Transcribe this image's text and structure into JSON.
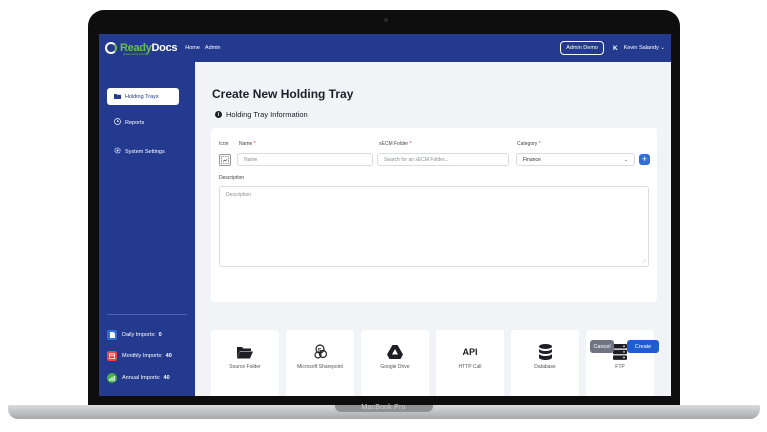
{
  "laptop": {
    "label": "MacBook Pro"
  },
  "topbar": {
    "logo_ready": "Ready",
    "logo_docs": "Docs",
    "logo_sub": "powered by iCenter",
    "nav": [
      "Home",
      "Admin"
    ],
    "admin_demo": "Admin Demo",
    "user_initial": "K",
    "user_name": "Kevin Salandy ⌄"
  },
  "sidebar": {
    "items": [
      {
        "label": "Holding Trays",
        "icon": "folder-icon",
        "active": true
      },
      {
        "label": "Reports",
        "icon": "clock-icon",
        "active": false
      },
      {
        "label": "System Settings",
        "icon": "gear-icon",
        "active": false
      }
    ],
    "stats": [
      {
        "label": "Daily Imports:",
        "value": "0",
        "color": "#2f6fd6",
        "icon": "document-icon"
      },
      {
        "label": "Monthly Imports:",
        "value": "40",
        "color": "#e24a4a",
        "icon": "calendar-icon"
      },
      {
        "label": "Annual Imports:",
        "value": "40",
        "color": "#4caf50",
        "icon": "chart-icon"
      }
    ]
  },
  "main": {
    "title": "Create New Holding Tray",
    "section_title": "Holding Tray Information",
    "form": {
      "icon_label": "Icon",
      "name_label": "Name",
      "name_placeholder": "Name",
      "folder_label": "xECM Folder",
      "folder_placeholder": "Search for an xECM Folder...",
      "category_label": "Category",
      "category_value": "Finance",
      "required_mark": "*",
      "description_label": "Description",
      "description_placeholder": "Description"
    },
    "sources": [
      {
        "label": "Source Folder",
        "icon": "folder-open-icon"
      },
      {
        "label": "Microsoft Sharepoint",
        "icon": "sharepoint-icon"
      },
      {
        "label": "Google Drive",
        "icon": "google-drive-icon"
      },
      {
        "label": "HTTP Call",
        "icon": "api-icon",
        "text": "API"
      },
      {
        "label": "Database",
        "icon": "database-icon"
      },
      {
        "label": "FTP",
        "icon": "server-icon"
      }
    ],
    "buttons": {
      "cancel": "Cancel",
      "create": "Create"
    }
  },
  "colors": {
    "primary": "#243a8e",
    "accent": "#1f5bd1",
    "brand_green": "#6ac04a"
  }
}
